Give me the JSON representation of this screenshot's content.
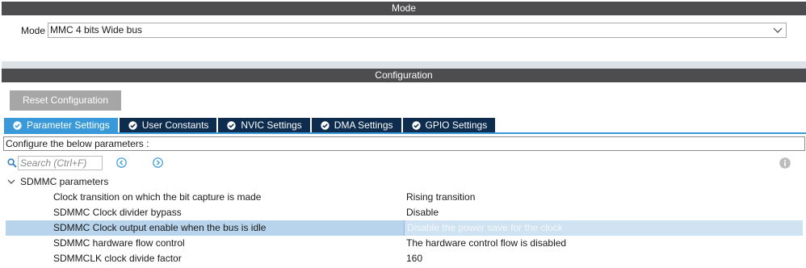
{
  "mode_section": {
    "header": "Mode",
    "label": "Mode",
    "selected": "MMC 4 bits Wide bus"
  },
  "config_section": {
    "header": "Configuration",
    "reset_label": "Reset Configuration",
    "tabs": [
      {
        "label": "Parameter Settings",
        "active": true,
        "icon": "check-circle-icon"
      },
      {
        "label": "User Constants",
        "active": false,
        "icon": "check-circle-icon"
      },
      {
        "label": "NVIC Settings",
        "active": false,
        "icon": "check-circle-icon"
      },
      {
        "label": "DMA Settings",
        "active": false,
        "icon": "check-circle-icon"
      },
      {
        "label": "GPIO Settings",
        "active": false,
        "icon": "check-circle-icon"
      }
    ],
    "info_text": "Configure the below parameters :",
    "search_placeholder": "Search (Ctrl+F)",
    "group_title": "SDMMC parameters",
    "params": [
      {
        "name": "Clock transition on which the bit capture is made",
        "value": "Rising transition",
        "selected": false
      },
      {
        "name": "SDMMC Clock divider bypass",
        "value": "Disable",
        "selected": false
      },
      {
        "name": "SDMMC Clock output enable when the bus is idle",
        "value": "Disable the power save for the clock",
        "selected": true
      },
      {
        "name": "SDMMC hardware flow control",
        "value": "The hardware control flow is disabled",
        "selected": false
      },
      {
        "name": "SDMMCLK clock divide factor",
        "value": "160",
        "selected": false
      }
    ]
  },
  "colors": {
    "header_bg": "#4d4d4f",
    "tab_active": "#3a9ad9",
    "tab_inactive": "#0e2c4e",
    "selected_row": "#b7d4ec",
    "nav_icon": "#3a9ad9"
  }
}
